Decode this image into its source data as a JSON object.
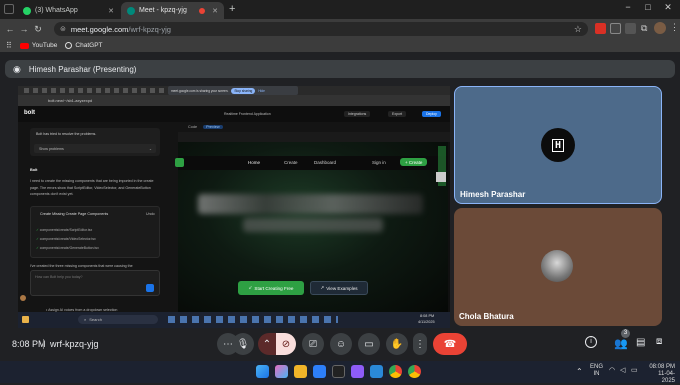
{
  "browser": {
    "tabs": [
      {
        "title": "(3) WhatsApp",
        "active": false,
        "favicon_color": "#25d366"
      },
      {
        "title": "Meet - kpzq-yjg",
        "active": true,
        "favicon_color": "#00897b"
      }
    ],
    "new_tab": "+",
    "window_controls": [
      "−",
      "□",
      "✕"
    ],
    "url_host": "meet.google.com",
    "url_path": "/wrf-kpzq-yjg",
    "bookmarks": [
      {
        "label": "YouTube",
        "icon": "youtube-icon",
        "color": "#ff0000"
      },
      {
        "label": "ChatGPT",
        "icon": "chatgpt-icon",
        "color": "#e8e8e8"
      }
    ]
  },
  "meet": {
    "presenter_label": "Himesh Parashar (Presenting)",
    "time": "8:08 PM",
    "meeting_code": "wrf-kpzq-yjg",
    "participants_badge": "3",
    "participants": [
      {
        "name": "Himesh Parashar",
        "avatar_text": "H"
      },
      {
        "name": "Chola Bhatura",
        "avatar_text": ""
      }
    ]
  },
  "shared_screen": {
    "inner_url": "bolt.new/~/sb1-axyzexpd",
    "sharing_text": "meet.google.com is sharing your screen.",
    "stop_sharing": "Stop sharing",
    "hide": "Hide",
    "bolt_logo": "bolt",
    "project_title": "Realtime Frontend Application",
    "header_actions": [
      "Integrations",
      "Export",
      "Deploy"
    ],
    "chat": {
      "problem_text": "Bolt has tried to resolve the problems.",
      "show_problems": "Show problems",
      "sender": "Bolt",
      "message": "I need to create the missing components that are being imported in the create page. The errors show that ScriptEditor, VideoSelector, and GenerateButton components don't exist yet.",
      "card_title": "Create Missing Create Page Components",
      "undo": "Undo",
      "files": [
        "components/create/ScriptEditor.tsx",
        "components/create/VideoSelector.tsx",
        "components/create/GenerateButton.tsx"
      ],
      "followup": "I've created the three missing components that were causing the",
      "input_placeholder": "How can Bolt help you today?",
      "bullet": "Assign AI voices from a dropdown selection"
    },
    "preview": {
      "tabs": [
        "Code",
        "Preview"
      ],
      "nav": [
        "Home",
        "Create",
        "Dashboard"
      ],
      "sign_in": "Sign in",
      "create_btn": "+ Create",
      "cta_primary": "Start Creating Free",
      "cta_secondary": "View Examples"
    },
    "taskbar_search": "Search",
    "taskbar_time": "8:08 PM",
    "taskbar_date": "4/11/2025"
  },
  "system": {
    "lang": "ENG",
    "region": "IN",
    "time": "08:08 PM",
    "date": "11-04-2025"
  },
  "colors": {
    "end_call": "#ea4335",
    "cam_off": "#f9dedc",
    "accent_green": "#2ea043",
    "tile_border": "#8ab4f8"
  }
}
